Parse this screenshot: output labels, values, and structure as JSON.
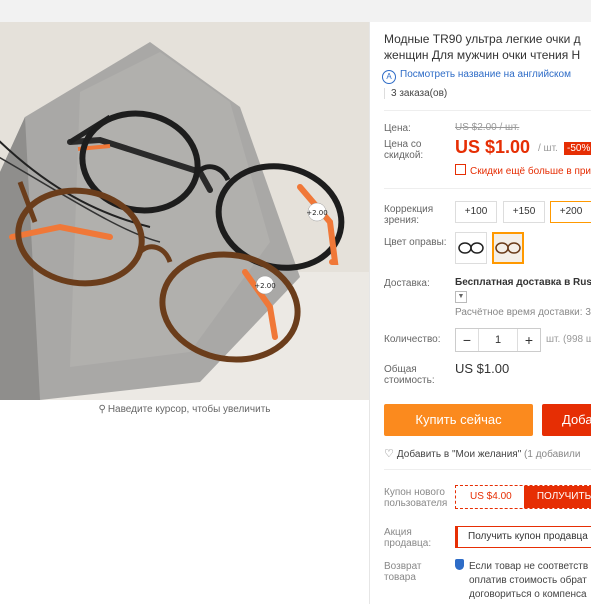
{
  "gallery": {
    "zoom_hint": "Наведите курсор, чтобы увеличить",
    "photo_frame_labels": [
      "+2.00",
      "+2.00"
    ]
  },
  "product": {
    "title_line1": "Модные TR90 ультра легкие очки д",
    "title_line2": "женщин Для мужчин очки чтения Н",
    "translate_link": "Посмотреть название на английском",
    "orders": "3 заказа(ов)",
    "price_label": "Цена:",
    "old_price": "US $2.00 / шт.",
    "discount_price_label_1": "Цена со",
    "discount_price_label_2": "скидкой:",
    "price": "US $1.00",
    "unit": "/ шт.",
    "discount_badge": "-50%",
    "quantity_discount": "Скидки ещё больше в прил"
  },
  "options": {
    "correction_label_1": "Коррекция",
    "correction_label_2": "зрения:",
    "correction_values": [
      "+100",
      "+150",
      "+200"
    ],
    "frame_color_label": "Цвет оправы:"
  },
  "shipping": {
    "label": "Доставка:",
    "value": "Бесплатная доставка в Rus",
    "dropdown_icon": "chevron-down-icon",
    "est_time": "Расчётное время доставки: 3"
  },
  "quantity": {
    "label": "Количество:",
    "minus": "−",
    "value": "1",
    "plus": "+",
    "available": "шт. (998 ш"
  },
  "total": {
    "label_1": "Общая",
    "label_2": "стоимость:",
    "value": "US $1.00"
  },
  "actions": {
    "buy_now": "Купить сейчас",
    "add_to_cart": "Доба",
    "wishlist": "Добавить в \"Мои желания\"",
    "wishlist_count": "(1 добавили"
  },
  "coupon": {
    "label_1": "Купон нового",
    "label_2": "пользователя",
    "amount": "US $4.00",
    "get_button": "ПОЛУЧИТЬ"
  },
  "promo": {
    "label_1": "Акция",
    "label_2": "продавца:",
    "text": "Получить купон продавца"
  },
  "returns": {
    "label_1": "Возврат",
    "label_2": "товара",
    "line_1": "Если товар не соответств",
    "line_2": "оплатив стоимость обрат",
    "line_3": "договориться о компенса"
  },
  "colors": {
    "accent_red": "#e62e04",
    "accent_orange": "#fb8a1e",
    "link_blue": "#2e6cc7"
  }
}
